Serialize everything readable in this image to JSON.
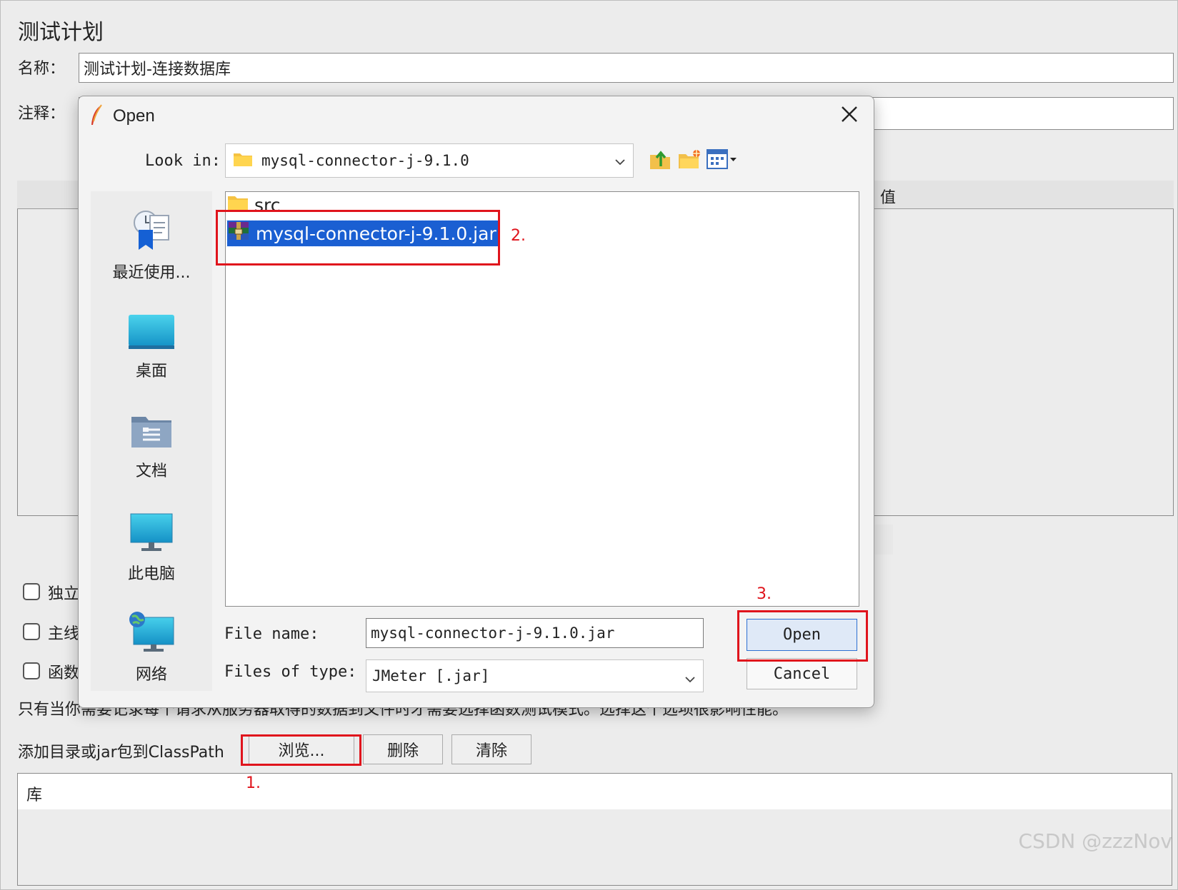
{
  "background": {
    "panel_title": "测试计划",
    "name_label": "名称：",
    "name_value": "测试计划-连接数据库",
    "comment_label": "注释：",
    "comment_value": "",
    "table_value_header": "值",
    "checkbox1_label": "独立",
    "checkbox2_label": "主线",
    "checkbox3_label": "函数",
    "hint_start": "只有当你",
    "hint_end": "需要记录每个请求从服务器取得的数据到文件时才需要选择函数测试模式。选择这个选项很影响性能。",
    "classpath_label": "添加目录或jar包到ClassPath",
    "browse_button": "浏览...",
    "delete_button": "删除",
    "clear_button": "清除",
    "library_header": "库"
  },
  "annotations": {
    "step1": "1.",
    "step2": "2.",
    "step3": "3."
  },
  "dialog": {
    "title": "Open",
    "look_in_label": "Look in:",
    "look_in_value": "mysql-connector-j-9.1.0",
    "toolbar": [
      "up-folder-icon",
      "new-folder-icon",
      "view-menu-icon"
    ],
    "places": [
      {
        "label": "最近使用...",
        "icon": "recent-icon"
      },
      {
        "label": "桌面",
        "icon": "desktop-icon"
      },
      {
        "label": "文档",
        "icon": "documents-icon"
      },
      {
        "label": "此电脑",
        "icon": "computer-icon"
      },
      {
        "label": "网络",
        "icon": "network-icon"
      }
    ],
    "files": [
      {
        "name": "src",
        "type": "folder"
      },
      {
        "name": "mysql-connector-j-9.1.0.jar",
        "type": "jar",
        "selected": true
      }
    ],
    "file_name_label": "File name:",
    "file_name_value": "mysql-connector-j-9.1.0.jar",
    "file_type_label": "Files of type:",
    "file_type_value": "JMeter [.jar]",
    "open_button": "Open",
    "cancel_button": "Cancel"
  },
  "watermark": "CSDN @zzzNov",
  "colors": {
    "selection": "#1a5fd2",
    "annotation_red": "#e0141c",
    "open_button_border": "#2d6fd2"
  }
}
